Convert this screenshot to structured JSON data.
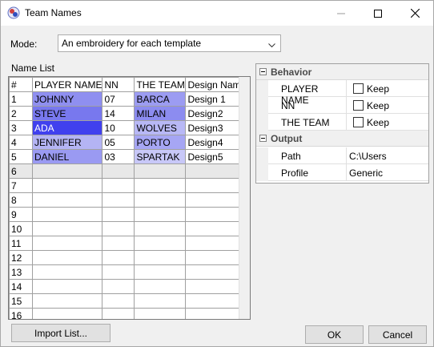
{
  "window": {
    "title": "Team Names"
  },
  "mode": {
    "label": "Mode:",
    "selected": "An embroidery for each template"
  },
  "name_list": {
    "label": "Name List",
    "columns": [
      "#",
      "PLAYER NAME",
      "NN",
      "THE TEAM",
      "Design Name"
    ],
    "rows": [
      {
        "num": "1",
        "player": "JOHNNY",
        "nn": "07",
        "team": "BARCA",
        "design": "Design 1"
      },
      {
        "num": "2",
        "player": "STEVE",
        "nn": "14",
        "team": "MILAN",
        "design": "Design2"
      },
      {
        "num": "3",
        "player": "ADA",
        "nn": "10",
        "team": "WOLVES",
        "design": "Design3"
      },
      {
        "num": "4",
        "player": "JENNIFER",
        "nn": "05",
        "team": "PORTO",
        "design": "Design4"
      },
      {
        "num": "5",
        "player": "DANIEL",
        "nn": "03",
        "team": "SPARTAK",
        "design": "Design5"
      }
    ],
    "empty_rows": [
      "6",
      "7",
      "8",
      "9",
      "10",
      "11",
      "12",
      "13",
      "14",
      "15",
      "16"
    ],
    "player_colors": [
      "#8f8ff0",
      "#7878ee",
      "#4040ee",
      "#b4b4f4",
      "#9a9af2"
    ],
    "team_colors": [
      "#9c9cf2",
      "#8c8cf0",
      "#b8b8f6",
      "#a6a6f4",
      "#c8c8f8"
    ]
  },
  "properties": {
    "behavior": {
      "title": "Behavior",
      "items": [
        {
          "name": "PLAYER NAME",
          "value": "Keep"
        },
        {
          "name": "NN",
          "value": "Keep"
        },
        {
          "name": "THE TEAM",
          "value": "Keep"
        }
      ]
    },
    "output": {
      "title": "Output",
      "items": [
        {
          "name": "Path",
          "value": "C:\\Users"
        },
        {
          "name": "Profile",
          "value": "Generic"
        }
      ]
    }
  },
  "buttons": {
    "import": "Import List...",
    "ok": "OK",
    "cancel": "Cancel"
  }
}
